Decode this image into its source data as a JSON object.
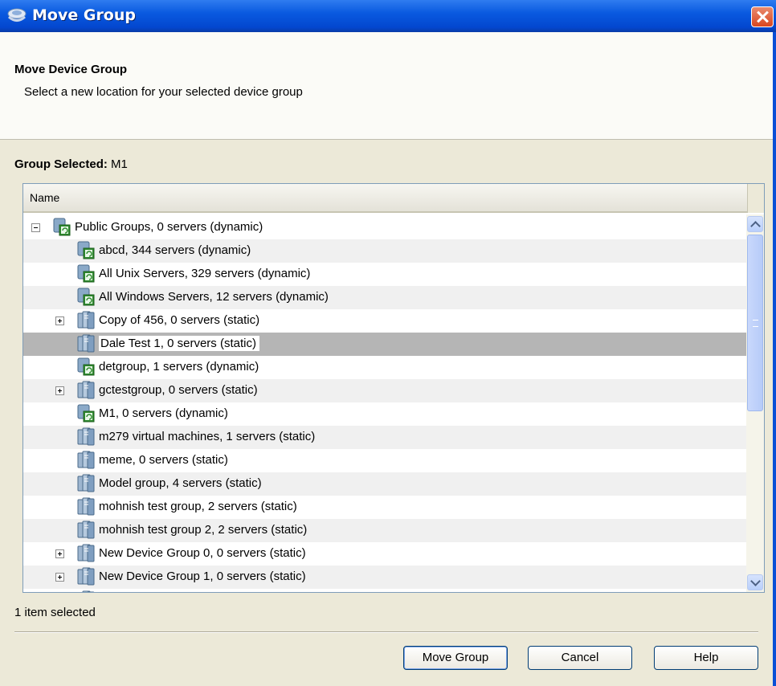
{
  "window": {
    "title": "Move Group",
    "icon": "device-group-icon",
    "close_icon": "close-icon"
  },
  "header": {
    "title": "Move Device Group",
    "subtitle": "Select a new location for your selected device group"
  },
  "selection": {
    "label": "Group Selected:",
    "value": "M1"
  },
  "tree": {
    "column_header": "Name",
    "rows": [
      {
        "label": "Public Groups, 0 servers (dynamic)",
        "type": "dynamic",
        "expander": "minus",
        "depth": 0,
        "selected": false
      },
      {
        "label": "abcd, 344 servers (dynamic)",
        "type": "dynamic",
        "expander": "none",
        "depth": 1,
        "selected": false
      },
      {
        "label": "All Unix Servers, 329 servers (dynamic)",
        "type": "dynamic",
        "expander": "none",
        "depth": 1,
        "selected": false
      },
      {
        "label": "All Windows Servers, 12 servers (dynamic)",
        "type": "dynamic",
        "expander": "none",
        "depth": 1,
        "selected": false
      },
      {
        "label": "Copy of 456, 0 servers (static)",
        "type": "static",
        "expander": "plus",
        "depth": 1,
        "selected": false
      },
      {
        "label": "Dale Test 1, 0 servers (static)",
        "type": "static",
        "expander": "none",
        "depth": 1,
        "selected": true
      },
      {
        "label": "detgroup, 1 servers (dynamic)",
        "type": "dynamic",
        "expander": "none",
        "depth": 1,
        "selected": false
      },
      {
        "label": "gctestgroup, 0 servers (static)",
        "type": "static",
        "expander": "plus",
        "depth": 1,
        "selected": false
      },
      {
        "label": "M1, 0 servers (dynamic)",
        "type": "dynamic",
        "expander": "none",
        "depth": 1,
        "selected": false
      },
      {
        "label": "m279 virtual machines, 1 servers (static)",
        "type": "static",
        "expander": "none",
        "depth": 1,
        "selected": false
      },
      {
        "label": "meme, 0 servers (static)",
        "type": "static",
        "expander": "none",
        "depth": 1,
        "selected": false
      },
      {
        "label": "Model group, 4 servers (static)",
        "type": "static",
        "expander": "none",
        "depth": 1,
        "selected": false
      },
      {
        "label": "mohnish test group, 2 servers (static)",
        "type": "static",
        "expander": "none",
        "depth": 1,
        "selected": false
      },
      {
        "label": "mohnish test group 2, 2 servers (static)",
        "type": "static",
        "expander": "none",
        "depth": 1,
        "selected": false
      },
      {
        "label": "New Device Group 0, 0 servers (static)",
        "type": "static",
        "expander": "plus",
        "depth": 1,
        "selected": false
      },
      {
        "label": "New Device Group 1, 0 servers (static)",
        "type": "static",
        "expander": "plus",
        "depth": 1,
        "selected": false
      },
      {
        "label": "",
        "type": "static",
        "expander": "none",
        "depth": 1,
        "selected": false
      }
    ]
  },
  "status": {
    "text": "1 item selected"
  },
  "buttons": {
    "move": "Move Group",
    "cancel": "Cancel",
    "help": "Help"
  },
  "colors": {
    "titlebar": "#0a5ae0",
    "selected_row": "#b5b5b5",
    "alt_row": "#f0f0f0",
    "dialog_bg": "#ece9d8"
  }
}
